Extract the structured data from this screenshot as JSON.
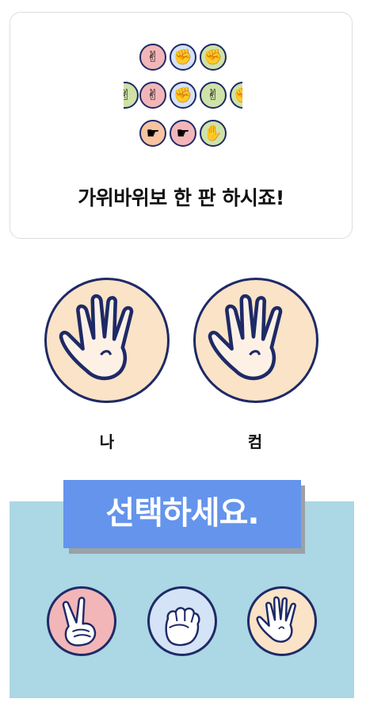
{
  "header": {
    "title": "가위바위보 한 판 하시죠!"
  },
  "pattern_icons": [
    {
      "icon": "scissors-hand-icon",
      "glyph": "✌",
      "color": "#f2b6b9"
    },
    {
      "icon": "rock-hand-icon",
      "glyph": "✊",
      "color": "#d4e3f6"
    },
    {
      "icon": "rock-hand-icon",
      "glyph": "✊",
      "color": "#cfe2a8"
    },
    {
      "icon": "scissors-hand-icon",
      "glyph": "✌",
      "color": "#f2b6b9"
    },
    {
      "icon": "rock-hand-icon",
      "glyph": "✊",
      "color": "#d4e3f6"
    },
    {
      "icon": "scissors-hand-icon",
      "glyph": "✌",
      "color": "#cfe2a8"
    },
    {
      "icon": "pointing-hand-icon",
      "glyph": "☛",
      "color": "#f7c3a0"
    },
    {
      "icon": "pointing-hand-icon",
      "glyph": "☛",
      "color": "#f2b6b9"
    },
    {
      "icon": "paper-hand-icon",
      "glyph": "✋",
      "color": "#cfe2a8"
    }
  ],
  "players": {
    "me": {
      "label": "나",
      "hand": "paper-hand-icon",
      "color": "#fae3c7"
    },
    "computer": {
      "label": "컴",
      "hand": "paper-hand-icon",
      "color": "#fae3c7"
    }
  },
  "selection": {
    "prompt": "선택하세요.",
    "panel_color": "#acd7e5",
    "prompt_color": "#6494ec",
    "choices": [
      {
        "name": "scissors",
        "icon": "scissors-hand-icon",
        "color": "#f2b6b9"
      },
      {
        "name": "rock",
        "icon": "rock-hand-icon",
        "color": "#d4e3f6"
      },
      {
        "name": "paper",
        "icon": "paper-hand-icon",
        "color": "#fae3c7"
      }
    ]
  }
}
